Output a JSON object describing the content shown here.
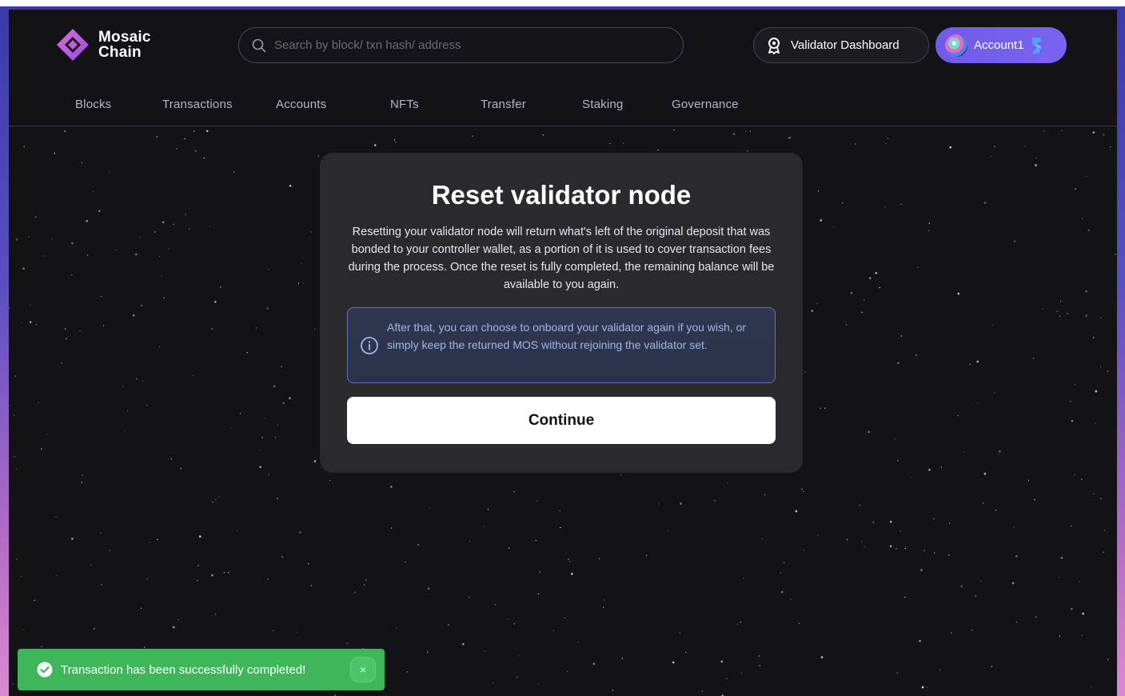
{
  "app": {
    "logo_line1": "Mosaic",
    "logo_line2": "Chain"
  },
  "search": {
    "placeholder": "Search by block/ txn hash/ address",
    "icon": "search-icon"
  },
  "header": {
    "validator_dashboard_label": "Validator Dashboard",
    "account_label": "Account1"
  },
  "nav": {
    "items": [
      {
        "label": "Blocks"
      },
      {
        "label": "Transactions"
      },
      {
        "label": "Accounts"
      },
      {
        "label": "NFTs"
      },
      {
        "label": "Transfer"
      },
      {
        "label": "Staking"
      },
      {
        "label": "Governance"
      }
    ]
  },
  "modal": {
    "title": "Reset validator node",
    "description": "Resetting your validator node will return what's left of the original deposit that was bonded to your controller wallet, as a portion of it is used to cover transaction fees during the process. Once the reset is fully completed, the remaining balance will be available to you again.",
    "info": "After that, you can choose to onboard your validator again if you wish, or simply keep the returned MOS without rejoining the validator set.",
    "continue_label": "Continue"
  },
  "toast": {
    "message": "Transaction has been successfully completed!",
    "close_label": "×"
  },
  "colors": {
    "background": "#131216",
    "accent": "#7561ee",
    "success": "#3fb65a",
    "info_border": "#5a73b8"
  }
}
